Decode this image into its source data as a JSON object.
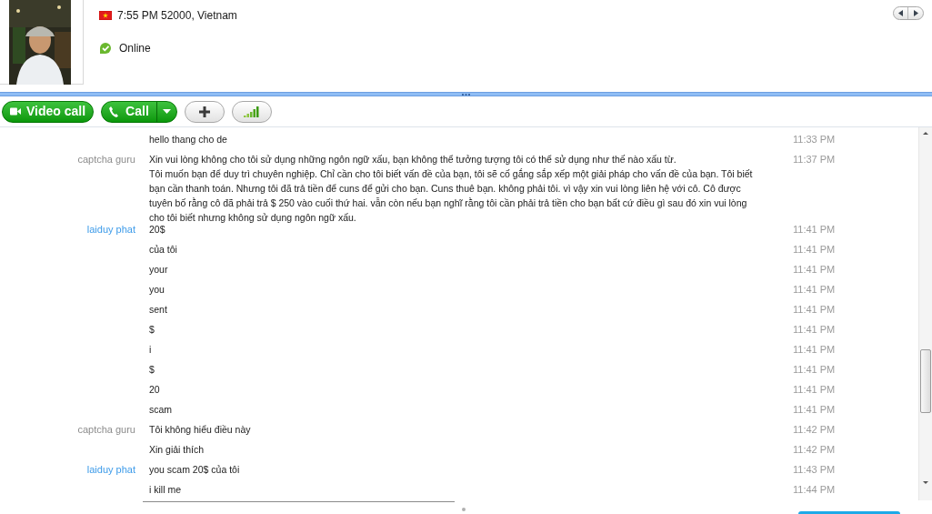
{
  "contact": {
    "local_time": "7:55 PM 52000, Vietnam",
    "status": "Online"
  },
  "toolbar": {
    "video_call": "Video call",
    "call": "Call"
  },
  "messages": [
    {
      "kind": "continuation",
      "lines": [
        "hello thang cho de"
      ],
      "time": "11:33 PM"
    },
    {
      "kind": "remote",
      "sender": "captcha guru",
      "lines": [
        "Xin vui lòng không cho tôi sử dụng những ngôn ngữ xấu, bạn không thể tưởng tượng tôi có thể sử dụng như thế nào xấu từ.",
        "Tôi muốn bạn để duy trì chuyên nghiệp. Chỉ cần cho tôi biết vấn đề của bạn, tôi sẽ cố gắng sắp xếp một giải pháp cho vấn đề của bạn. Tôi biết",
        "bạn cần thanh toán. Nhưng tôi đã trả tiền để cuns để gửi cho bạn. Cuns thuê bạn. không phải tôi. vì vậy xin vui lòng liên hệ với cô. Cô được",
        "tuyên bố rằng cô đã phải trả $ 250 vào cuối thứ hai. vẫn còn nếu bạn nghĩ rằng tôi cần phải trả tiền cho bạn bất cứ điều gì sau đó xin vui lòng",
        "cho tôi biết nhưng không sử dụng ngôn ngữ xấu."
      ],
      "time": "11:37 PM"
    },
    {
      "kind": "local",
      "sender": "laiduy phat",
      "lines": [
        "20$"
      ],
      "time": "11:41 PM"
    },
    {
      "kind": "continuation",
      "lines": [
        "của tôi"
      ],
      "time": "11:41 PM"
    },
    {
      "kind": "continuation",
      "lines": [
        "your"
      ],
      "time": "11:41 PM"
    },
    {
      "kind": "continuation",
      "lines": [
        "you"
      ],
      "time": "11:41 PM"
    },
    {
      "kind": "continuation",
      "lines": [
        "sent"
      ],
      "time": "11:41 PM"
    },
    {
      "kind": "continuation",
      "lines": [
        "$"
      ],
      "time": "11:41 PM"
    },
    {
      "kind": "continuation",
      "lines": [
        "i"
      ],
      "time": "11:41 PM"
    },
    {
      "kind": "continuation",
      "lines": [
        "$"
      ],
      "time": "11:41 PM"
    },
    {
      "kind": "continuation",
      "lines": [
        "20"
      ],
      "time": "11:41 PM"
    },
    {
      "kind": "continuation",
      "lines": [
        "scam"
      ],
      "time": "11:41 PM"
    },
    {
      "kind": "remote",
      "sender": "captcha guru",
      "lines": [
        "Tôi không hiểu điều này"
      ],
      "time": "11:42 PM"
    },
    {
      "kind": "continuation",
      "lines": [
        "Xin giải thích"
      ],
      "time": "11:42 PM"
    },
    {
      "kind": "local",
      "sender": "laiduy phat",
      "lines": [
        "you scam 20$ của tôi"
      ],
      "time": "11:43 PM"
    },
    {
      "kind": "continuation",
      "lines": [
        "i kill me"
      ],
      "time": "11:44 PM"
    }
  ]
}
